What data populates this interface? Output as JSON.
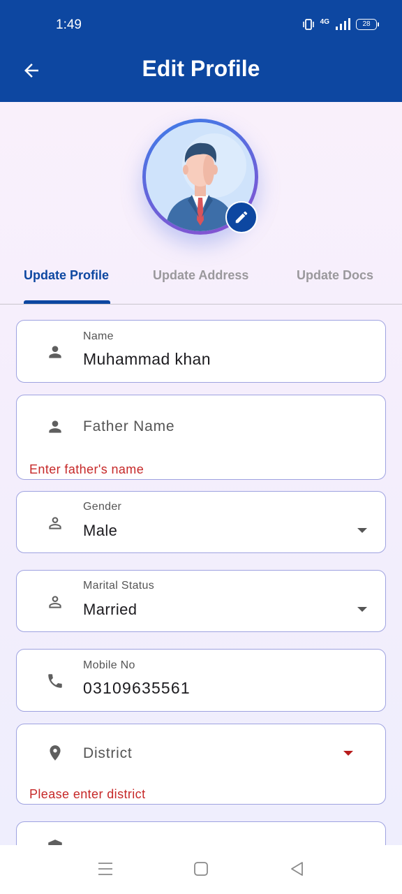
{
  "status": {
    "time": "1:49",
    "network": "4G",
    "battery": "28"
  },
  "appbar": {
    "title": "Edit Profile"
  },
  "tabs": [
    {
      "label": "Update Profile",
      "active": true
    },
    {
      "label": "Update Address",
      "active": false
    },
    {
      "label": "Update Docs",
      "active": false
    }
  ],
  "form": {
    "name": {
      "label": "Name",
      "value": "Muhammad khan",
      "icon": "person-icon"
    },
    "father_name": {
      "placeholder": "Father Name",
      "error": "Enter father's name",
      "icon": "person-icon"
    },
    "gender": {
      "label": "Gender",
      "value": "Male",
      "icon": "person-outline-icon"
    },
    "marital_status": {
      "label": "Marital Status",
      "value": "Married",
      "icon": "person-outline-icon"
    },
    "mobile": {
      "label": "Mobile No",
      "value": "03109635561",
      "icon": "phone-icon"
    },
    "district": {
      "placeholder": "District",
      "error": "Please enter district",
      "icon": "location-pin-icon"
    }
  },
  "colors": {
    "primary": "#0d47a1",
    "error": "#c62828",
    "border": "#9ea2e0"
  }
}
